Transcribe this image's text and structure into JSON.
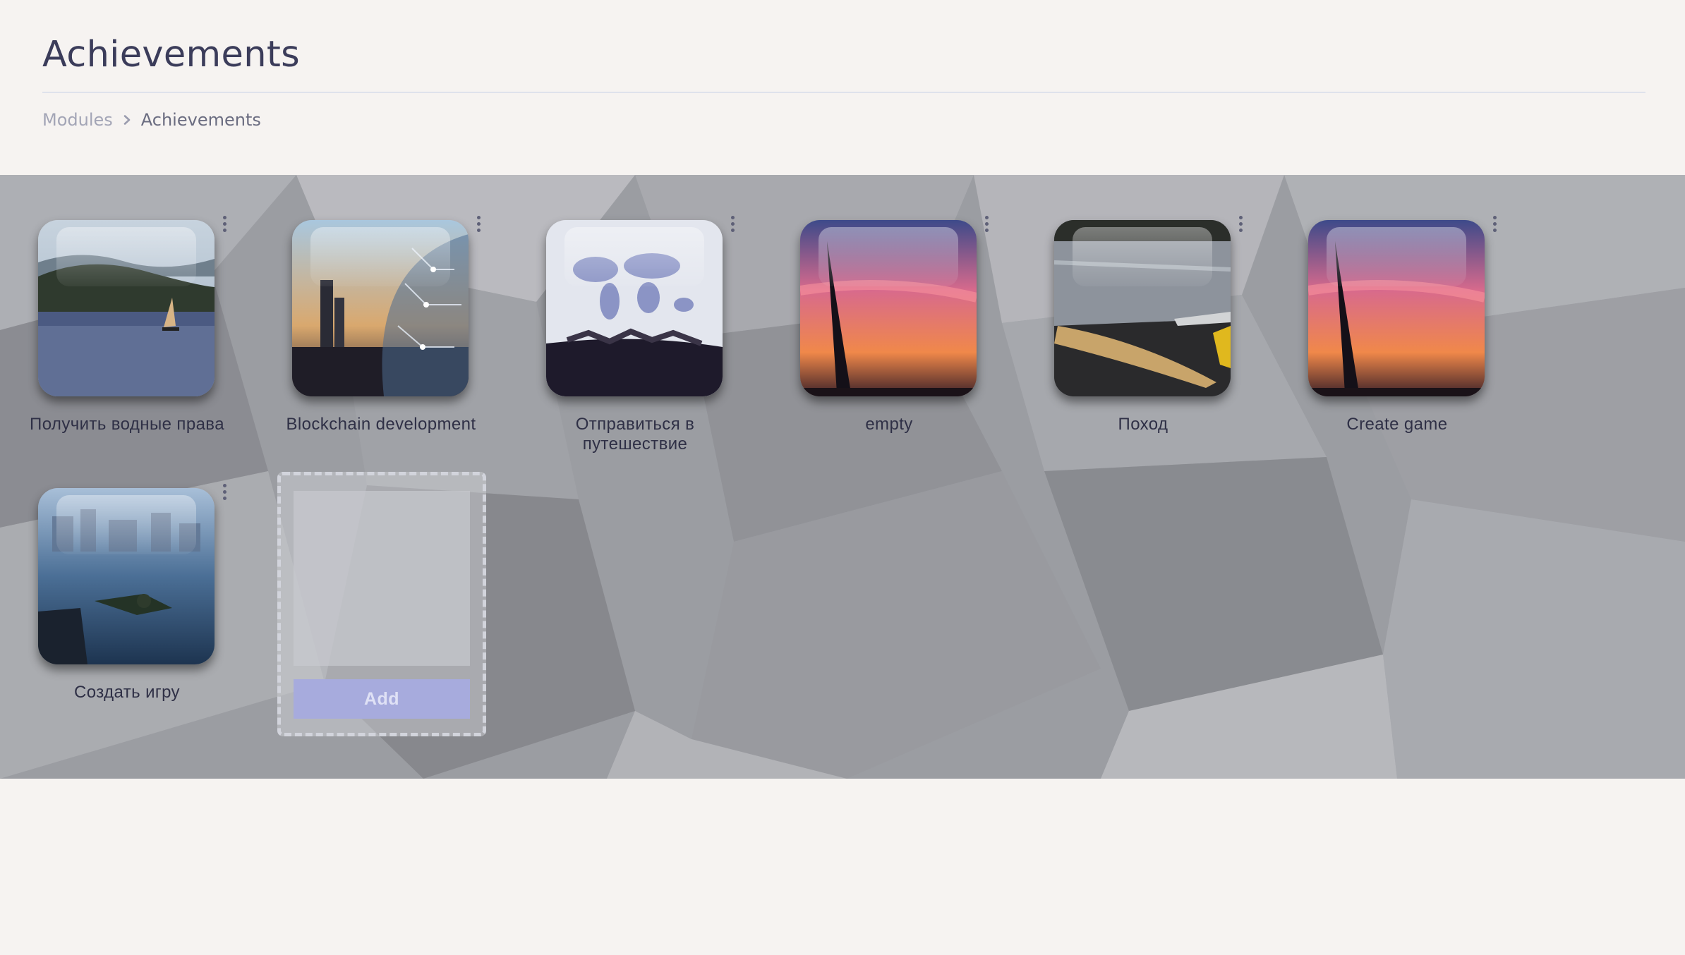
{
  "header": {
    "title": "Achievements"
  },
  "breadcrumb": {
    "items": [
      {
        "label": "Modules"
      },
      {
        "label": "Achievements"
      }
    ]
  },
  "achievements": [
    {
      "title": "Получить водные права",
      "image": "sailboat-lake"
    },
    {
      "title": "Blockchain development",
      "image": "city-circuit-globe"
    },
    {
      "title": "Отправиться в путешествие",
      "image": "world-map-travel"
    },
    {
      "title": "empty",
      "image": "sunset-monument"
    },
    {
      "title": "Поход",
      "image": "kayak-river"
    },
    {
      "title": "Create game",
      "image": "sunset-monument"
    },
    {
      "title": "Создать игру",
      "image": "diver-city-game"
    }
  ],
  "add_card": {
    "button_label": "Add"
  },
  "icons": {
    "breadcrumb_separator": "chevron-right-icon",
    "card_menu": "kebab-menu-icon"
  },
  "colors": {
    "title": "#3b3c5a",
    "accent_button": "#a7abdd",
    "page_background": "#f6f3f1"
  }
}
